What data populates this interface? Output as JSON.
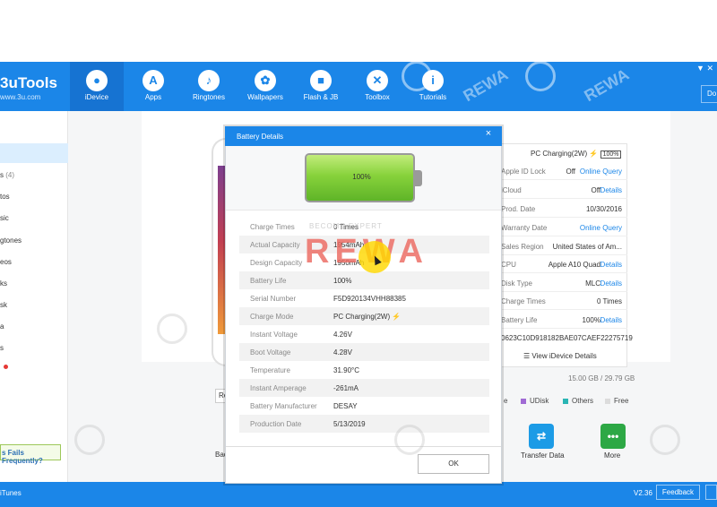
{
  "app": {
    "logo_text": "3uTools",
    "logo_sub": "www.3u.com",
    "window_controls": "▼ ✕",
    "download_label": "Do"
  },
  "nav": {
    "items": [
      {
        "label": "iDevice",
        "icon": "apple-icon"
      },
      {
        "label": "Apps",
        "icon": "apps-icon"
      },
      {
        "label": "Ringtones",
        "icon": "bell-icon"
      },
      {
        "label": "Wallpapers",
        "icon": "flower-icon"
      },
      {
        "label": "Flash & JB",
        "icon": "box-icon"
      },
      {
        "label": "Toolbox",
        "icon": "tools-icon"
      },
      {
        "label": "Tutorials",
        "icon": "info-icon"
      }
    ]
  },
  "sidebar": {
    "items": [
      {
        "label": "s",
        "badge": "(4)"
      },
      {
        "label": "tos"
      },
      {
        "label": "sic"
      },
      {
        "label": "gtones"
      },
      {
        "label": "eos"
      },
      {
        "label": "ks"
      },
      {
        "label": "sk"
      },
      {
        "label": "a"
      },
      {
        "label": "s"
      }
    ],
    "fails_text": "s Fails Frequently?"
  },
  "device": {
    "phone_btn": "Re",
    "bottom_label": "Bac"
  },
  "info": {
    "charge_status": "PC Charging(2W)",
    "charge_pct": "100%",
    "rows": [
      {
        "label": "Apple ID Lock",
        "value": "Off",
        "link": "Online Query"
      },
      {
        "label": "iCloud",
        "value": "Off",
        "link": "Details"
      },
      {
        "label": "Prod. Date",
        "value": "10/30/2016",
        "link": ""
      },
      {
        "label": "Warranty Date",
        "value": "",
        "link": "Online Query"
      },
      {
        "label": "Sales Region",
        "value": "United States of Am...",
        "link": ""
      },
      {
        "label": "CPU",
        "value": "Apple A10 Quad",
        "link": "Details"
      },
      {
        "label": "Disk Type",
        "value": "MLC",
        "link": "Details"
      },
      {
        "label": "Charge Times",
        "value": "0 Times",
        "link": ""
      },
      {
        "label": "Battery Life",
        "value": "100%",
        "link": "Details"
      }
    ],
    "serial_line": "0623C10D918182BAE07CAEF22275719",
    "view_details": "View iDevice Details",
    "storage": "15.00 GB / 29.79 GB",
    "legend": [
      {
        "label": "e",
        "color": "#f1a33c"
      },
      {
        "label": "UDisk",
        "color": "#a06ad4"
      },
      {
        "label": "Others",
        "color": "#2ab5b4"
      },
      {
        "label": "Free",
        "color": "#dcdcdc"
      }
    ]
  },
  "tiles": [
    {
      "label": "Transfer Data",
      "color": "#1c9be6",
      "icon": "transfer-icon"
    },
    {
      "label": "More",
      "color": "#2da845",
      "icon": "more-icon",
      "glyph": "•••"
    }
  ],
  "status": {
    "left": "iTunes",
    "version": "V2.36",
    "feedback": "Feedback"
  },
  "modal": {
    "title": "Battery Details",
    "close_glyph": "×",
    "battery_percent": "100%",
    "rows": [
      {
        "label": "Charge Times",
        "value": "0 Times"
      },
      {
        "label": "Actual Capacity",
        "value": "1954mAh"
      },
      {
        "label": "Design Capacity",
        "value": "1950mAh"
      },
      {
        "label": "Battery Life",
        "value": "100%"
      },
      {
        "label": "Serial Number",
        "value": "F5D920134VHH88385"
      },
      {
        "label": "Charge Mode",
        "value": "PC Charging(2W)"
      },
      {
        "label": "Instant Voltage",
        "value": "4.26V"
      },
      {
        "label": "Boot Voltage",
        "value": "4.28V"
      },
      {
        "label": "Temperature",
        "value": "31.90°C"
      },
      {
        "label": "Instant Amperage",
        "value": "-261mA"
      },
      {
        "label": "Battery Manufacturer",
        "value": "DESAY"
      },
      {
        "label": "Production Date",
        "value": "5/13/2019"
      }
    ],
    "ok_label": "OK"
  },
  "watermark": {
    "brand": "REWA",
    "sub": "BECOME EXPERT",
    "corner": "REWA"
  },
  "colors": {
    "brand_blue": "#1b86e8",
    "bolt_green": "#35b24b",
    "battery_green": "#87d23b",
    "link_blue": "#1b86e8"
  }
}
